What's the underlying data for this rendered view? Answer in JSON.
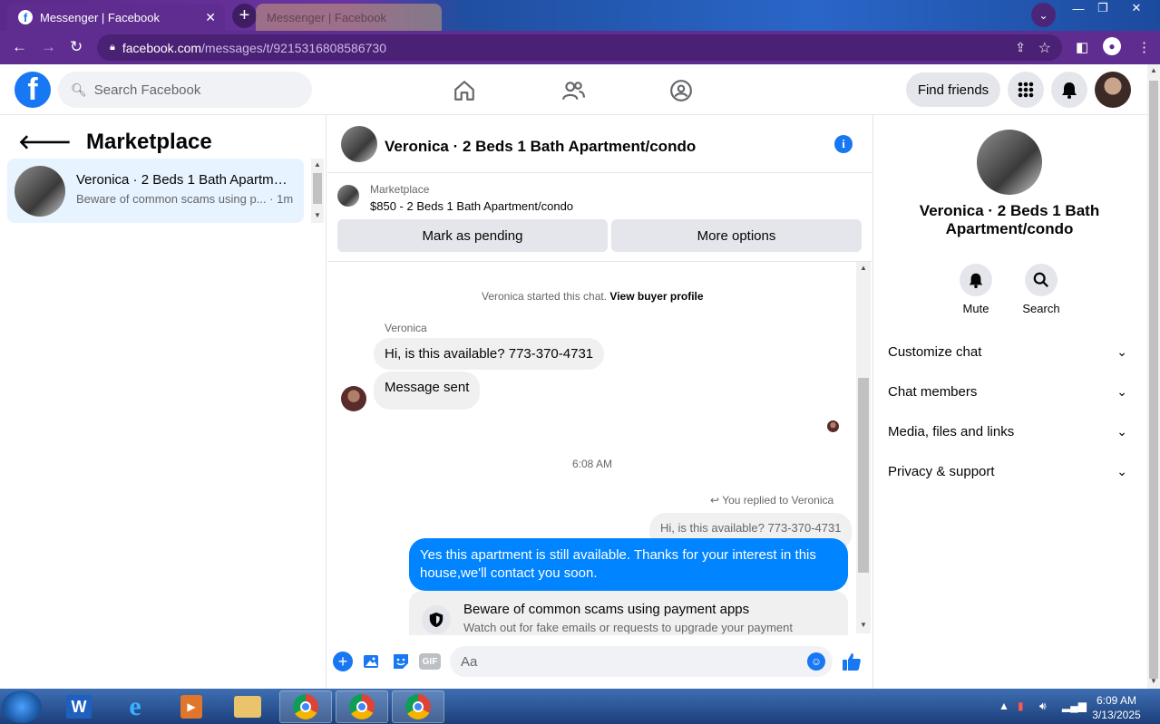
{
  "browser": {
    "active_tab_title": "Messenger | Facebook",
    "inactive_tab_title": "Messenger | Facebook",
    "url_host": "facebook.com",
    "url_path": "/messages/t/9215316808586730"
  },
  "header": {
    "search_placeholder": "Search Facebook",
    "find_friends_label": "Find friends"
  },
  "left": {
    "title": "Marketplace",
    "conversations": [
      {
        "name": "Veronica · 2 Beds 1 Bath Apartment/condo",
        "preview": "Beware of common scams using p...",
        "time": "· 1m"
      }
    ]
  },
  "chat": {
    "title": "Veronica · 2 Beds 1 Bath Apartment/condo",
    "listing_source": "Marketplace",
    "listing_detail": "$850 - 2 Beds 1 Bath Apartment/condo",
    "mark_pending_label": "Mark as pending",
    "more_options_label": "More options",
    "started_text": "Veronica started this chat.",
    "view_buyer_label": "View buyer profile",
    "sender_name": "Veronica",
    "incoming_messages": [
      "Hi, is this available? 773-370-4731",
      "Message sent"
    ],
    "timestamp": "6:08 AM",
    "replied_label": "You replied to Veronica",
    "quoted_message": "Hi, is this available? 773-370-4731",
    "outgoing_message": "Yes this apartment is still available. Thanks for your interest in this house,we'll contact you soon.",
    "scam_title": "Beware of common scams using payment apps",
    "scam_text": "Watch out for fake emails or requests to upgrade your payment",
    "composer_placeholder": "Aa"
  },
  "right": {
    "name": "Veronica · 2 Beds 1 Bath Apartment/condo",
    "actions": [
      "Mute",
      "Search"
    ],
    "sections": [
      "Customize chat",
      "Chat members",
      "Media, files and links",
      "Privacy & support"
    ]
  },
  "taskbar": {
    "time": "6:09 AM",
    "date": "3/13/2025"
  },
  "colors": {
    "brand": "#1877f2",
    "outgoing_bubble": "#0084ff",
    "browser_frame": "#5e2d8f"
  }
}
